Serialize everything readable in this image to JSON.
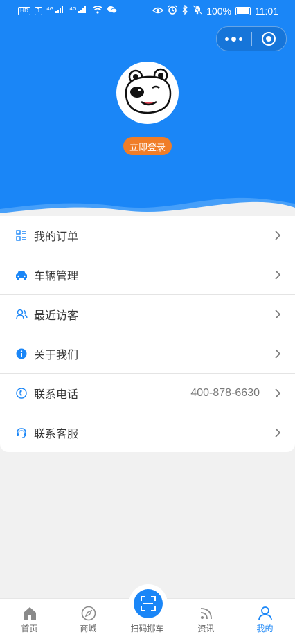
{
  "status_bar": {
    "left_badge_1": "HD",
    "left_badge_2": "1",
    "signal_1": "4G",
    "signal_2": "4G",
    "battery_percent": "100%",
    "time": "11:01"
  },
  "profile": {
    "login_label": "立即登录"
  },
  "menu": {
    "items": [
      {
        "label": "我的订单",
        "icon": "list-icon"
      },
      {
        "label": "车辆管理",
        "icon": "car-icon"
      },
      {
        "label": "最近访客",
        "icon": "users-icon"
      },
      {
        "label": "关于我们",
        "icon": "info-icon"
      },
      {
        "label": "联系电话",
        "icon": "phone-icon",
        "value": "400-878-6630"
      },
      {
        "label": "联系客服",
        "icon": "headset-icon"
      }
    ]
  },
  "tabbar": {
    "tabs": [
      {
        "label": "首页",
        "icon": "home-icon"
      },
      {
        "label": "商城",
        "icon": "compass-icon"
      },
      {
        "label": "扫码挪车",
        "icon": "scan-icon"
      },
      {
        "label": "资讯",
        "icon": "rss-icon"
      },
      {
        "label": "我的",
        "icon": "person-icon",
        "active": true
      }
    ]
  },
  "colors": {
    "primary": "#1a86f7",
    "login_button": "#f07d27",
    "icon_blue": "#1a86f7"
  }
}
